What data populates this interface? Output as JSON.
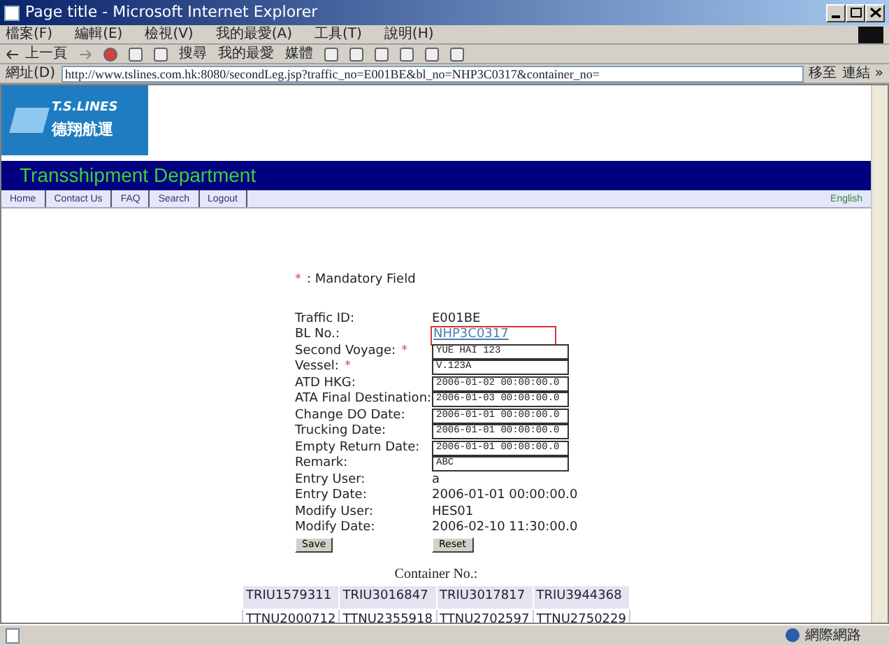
{
  "window": {
    "title": "Page title - Microsoft Internet Explorer"
  },
  "menu": [
    "檔案(F)",
    "編輯(E)",
    "檢視(V)",
    "我的最愛(A)",
    "工具(T)",
    "說明(H)"
  ],
  "toolbar": {
    "back": "上一頁",
    "search": "搜尋",
    "favorites": "我的最愛",
    "media": "媒體"
  },
  "address_bar": {
    "label": "網址(D)",
    "value": "http://www.tslines.com.hk:8080/secondLeg.jsp?traffic_no=E001BE&bl_no=NHP3C0317&container_no=",
    "go": "移至",
    "links": "連結 »"
  },
  "logo": {
    "name": "T.S.LINES",
    "name_cn": "德翔航運"
  },
  "banner": "Transshipment Department",
  "nav": [
    "Home",
    "Contact Us",
    "FAQ",
    "Search",
    "Logout"
  ],
  "language_link": "English",
  "mandatory_note": {
    "mark": "*",
    "text": ": Mandatory Field"
  },
  "fields": [
    {
      "label": "Traffic ID:",
      "kind": "text",
      "value": "E001BE",
      "required": false
    },
    {
      "label": "BL No.:",
      "kind": "link",
      "value": "NHP3C0317",
      "required": false,
      "highlighted": true
    },
    {
      "label": "Second Voyage:",
      "kind": "input",
      "value": "YUE HAI 123",
      "required": true
    },
    {
      "label": "Vessel:",
      "kind": "input",
      "value": "V.123A",
      "required": true
    },
    {
      "label": "ATD HKG:",
      "kind": "input",
      "value": "2006-01-02 00:00:00.0",
      "required": false
    },
    {
      "label": "ATA Final Destination:",
      "kind": "input",
      "value": "2006-01-03 00:00:00.0",
      "required": false
    },
    {
      "label": "Change DO Date:",
      "kind": "input",
      "value": "2006-01-01 00:00:00.0",
      "required": false
    },
    {
      "label": "Trucking Date:",
      "kind": "input",
      "value": "2006-01-01 00:00:00.0",
      "required": false
    },
    {
      "label": "Empty Return Date:",
      "kind": "input",
      "value": "2006-01-01 00:00:00.0",
      "required": false
    },
    {
      "label": "Remark:",
      "kind": "input",
      "value": "ABC",
      "required": false
    },
    {
      "label": "Entry User:",
      "kind": "text",
      "value": "a",
      "required": false
    },
    {
      "label": "Entry Date:",
      "kind": "text",
      "value": "2006-01-01 00:00:00.0",
      "required": false
    },
    {
      "label": "Modify User:",
      "kind": "text",
      "value": "HES01",
      "required": false
    },
    {
      "label": "Modify Date:",
      "kind": "text",
      "value": "2006-02-10 11:30:00.0",
      "required": false
    }
  ],
  "buttons": [
    "Save",
    "Reset"
  ],
  "containers": {
    "title": "Container No.:",
    "rows": [
      [
        "TRIU1579311",
        "TRIU3016847",
        "TRIU3017817",
        "TRIU3944368"
      ],
      [
        "TTNU2000712",
        "TTNU2355918",
        "TTNU2702597",
        "TTNU2750229"
      ]
    ]
  },
  "status_bar": {
    "zone": "網際網路"
  }
}
